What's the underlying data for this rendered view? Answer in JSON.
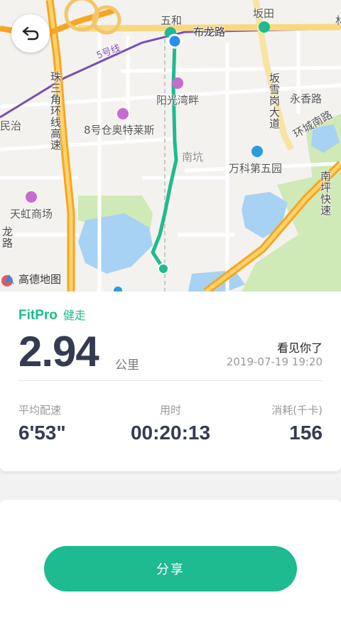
{
  "map": {
    "labels": {
      "wuhe": "五和",
      "bantian": "坂田",
      "bulong_road": "布龙路",
      "line5": "5号线",
      "zhusanjiao": "珠三角环线高速",
      "yangguangwanpan": "阳光湾畔",
      "bantian_xuegang": "坂雪岗大道",
      "yongxiang_road": "永香路",
      "minzhi": "民治",
      "outlet": "8号仓奥特莱斯",
      "huancheng_south": "环城南路",
      "nankeng": "南坑",
      "vanke": "万科第五园",
      "nanping": "南坪快速",
      "tianhong": "天虹商场",
      "longsa": "龙路",
      "partial_lin": "林"
    },
    "attribution": "高德地图"
  },
  "back_button": {
    "icon": "back-arrow-icon"
  },
  "summary": {
    "brand": "FitPro",
    "activity_type": "健走",
    "distance": "2.94",
    "distance_unit": "公里",
    "nickname": "看见你了",
    "datetime": "2019-07-19 19:20",
    "stats": [
      {
        "label": "平均配速",
        "value": "6'53\""
      },
      {
        "label": "用时",
        "value": "00:20:13"
      },
      {
        "label": "消耗(千卡)",
        "value": "156"
      }
    ]
  },
  "share": {
    "label": "分享"
  },
  "colors": {
    "accent": "#1dbb8f",
    "text_dark": "#353b50",
    "route": "#1dbb8f",
    "start_dot": "#2a8df0"
  }
}
